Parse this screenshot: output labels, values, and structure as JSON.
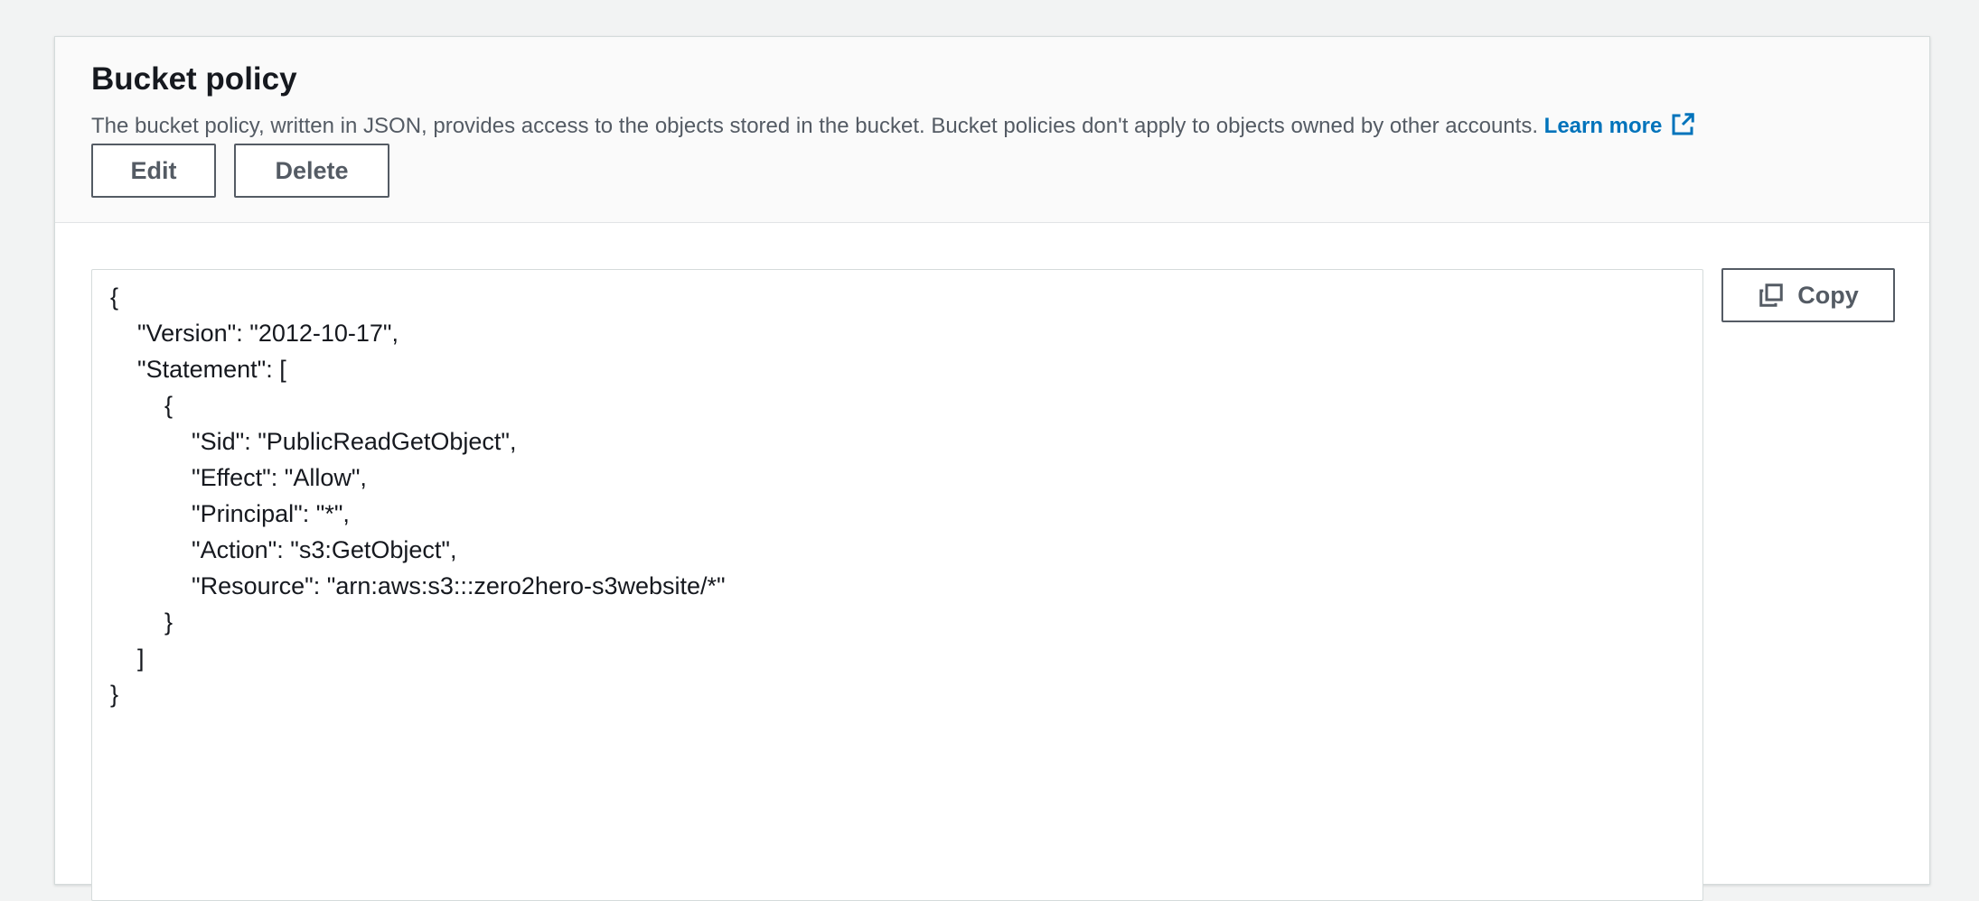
{
  "bucket_policy": {
    "title": "Bucket policy",
    "description": "The bucket policy, written in JSON, provides access to the objects stored in the bucket. Bucket policies don't apply to objects owned by other accounts. ",
    "learn_more_label": "Learn more",
    "learn_more_icon": "external-link-icon",
    "edit_label": "Edit",
    "delete_label": "Delete",
    "copy_label": "Copy",
    "copy_icon": "copy-icon",
    "policy_json": "{\n    \"Version\": \"2012-10-17\",\n    \"Statement\": [\n        {\n            \"Sid\": \"PublicReadGetObject\",\n            \"Effect\": \"Allow\",\n            \"Principal\": \"*\",\n            \"Action\": \"s3:GetObject\",\n            \"Resource\": \"arn:aws:s3:::zero2hero-s3website/*\"\n        }\n    ]\n}"
  },
  "colors": {
    "link": "#0073bb",
    "button_border": "#545b64",
    "header_background": "#fafafa",
    "page_background": "#f2f3f3"
  }
}
